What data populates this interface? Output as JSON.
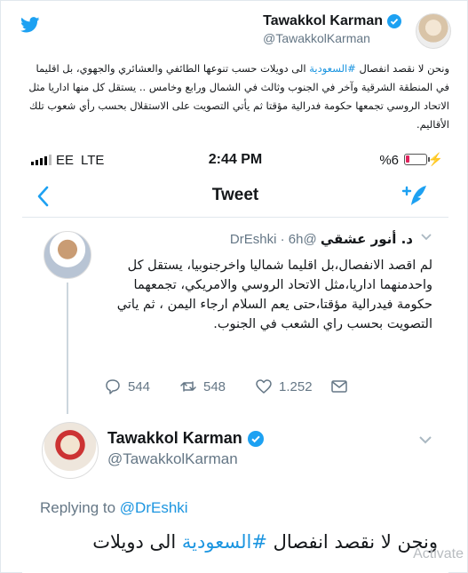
{
  "top_tweet": {
    "name": "Tawakkol Karman",
    "handle": "@TawakkolKarman",
    "text_before_hashtag": "ونحن لا نقصد انفصال ",
    "hashtag": "#السعودية",
    "text_after_hashtag": " الى دويلات حسب تنوعها الطائفي والعشائري والجهوي، بل اقليما في المنطقة الشرقية وآخر في الجنوب وثالث في الشمال ورابع وخامس .. يستقل كل منها اداريا مثل الاتحاد الروسي تجمعها حكومة فدرالية مؤقتا ثم يأتي التصويت على الاستقلال بحسب رأي شعوب تلك الأقاليم."
  },
  "status_bar": {
    "carrier": "EE",
    "network": "LTE",
    "time": "2:44 PM",
    "battery": "%6",
    "bolt": "⚡"
  },
  "nav": {
    "title": "Tweet"
  },
  "reply_tweet": {
    "name": "د. أنور عشقي",
    "handle": "@DrEshki",
    "time": "· 6h",
    "text": "لم اقصد الانفصال،بل اقليما شماليا واخرجنوبيا، يستقل كل واحدمنهما اداريا،مثل الاتحاد الروسي والامريكي، تجمعهما حكومة فيدرالية مؤقتا،حتى يعم السلام ارجاء اليمن ، ثم ياتي التصويت بحسب راي الشعب في الجنوب.",
    "replies": "544",
    "retweets": "548",
    "likes": "1.252"
  },
  "main_tweet": {
    "name": "Tawakkol Karman",
    "handle": "@TawakkolKarman",
    "replying_prefix": "Replying to ",
    "replying_to": "@DrEshki",
    "text_before_hashtag": "ونحن لا نقصد انفصال ",
    "hashtag": "#السعودية",
    "text_after_hashtag": " الى دويلات"
  },
  "watermark": "Activate",
  "colors": {
    "twitter_blue": "#1b95e0",
    "muted": "#657786"
  }
}
